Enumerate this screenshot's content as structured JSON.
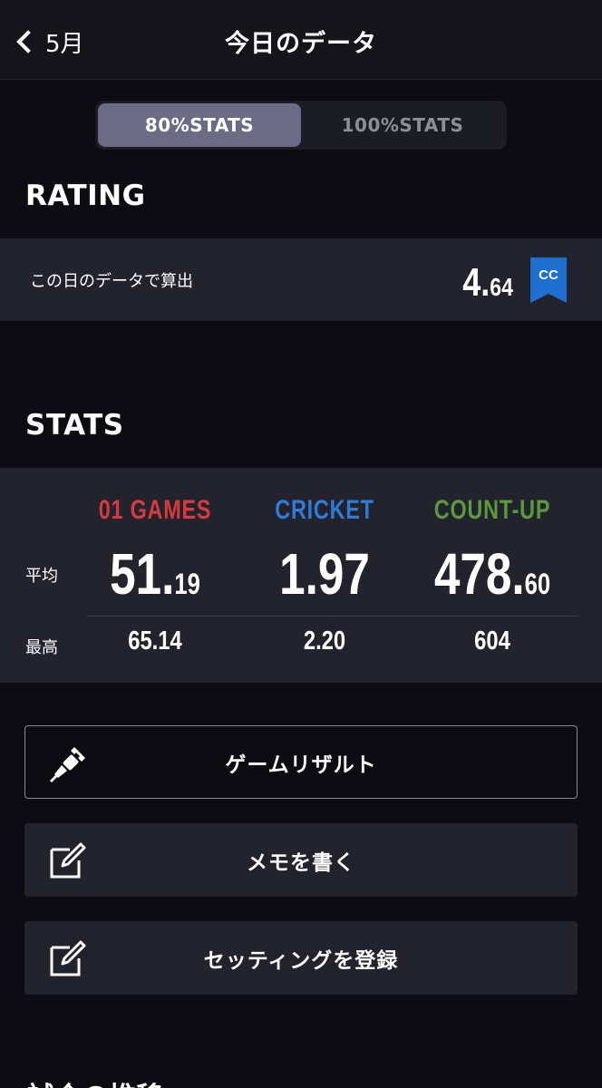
{
  "header": {
    "back_label": "5月",
    "title": "今日のデータ"
  },
  "segment": {
    "options": [
      "80%STATS",
      "100%STATS"
    ],
    "selected": "80%STATS"
  },
  "rating": {
    "section_title": "RATING",
    "label": "この日のデータで算出",
    "value_int": "4.",
    "value_dec": "64",
    "flag_text": "CC",
    "flag_color": "#1f6fd1"
  },
  "stats": {
    "section_title": "STATS",
    "row_labels": {
      "avg": "平均",
      "max": "最高"
    },
    "columns": [
      {
        "name": "01 GAMES",
        "color": "#d63a3f",
        "avg_int": "51.",
        "avg_dec": "19",
        "max": "65.14"
      },
      {
        "name": "CRICKET",
        "color": "#2e7bd9",
        "avg_int": "1.97",
        "avg_dec": "",
        "max": "2.20"
      },
      {
        "name": "COUNT-UP",
        "color": "#5b9a3c",
        "avg_int": "478.",
        "avg_dec": "60",
        "max": "604"
      }
    ]
  },
  "actions": [
    {
      "label": "ゲームリザルト",
      "icon": "dart-icon"
    },
    {
      "label": "メモを書く",
      "icon": "edit-icon"
    },
    {
      "label": "セッティングを登録",
      "icon": "edit-icon"
    }
  ],
  "next_section_title": "試合の推移"
}
